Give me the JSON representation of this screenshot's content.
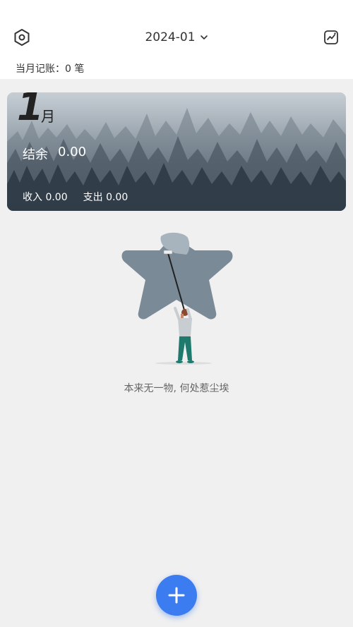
{
  "header": {
    "month": "2024-01",
    "count_label": "当月记账：",
    "count_value": "0 笔"
  },
  "card": {
    "month_number": "1",
    "month_unit": "月",
    "balance_label": "结余",
    "balance_value": "0.00",
    "income_label": "收入",
    "income_value": "0.00",
    "expense_label": "支出",
    "expense_value": "0.00"
  },
  "empty_state": {
    "message": "本来无一物, 何处惹尘埃"
  },
  "icons": {
    "settings": "settings-hexagon-icon",
    "month_dropdown": "chevron-down-icon",
    "stats": "chart-trend-icon",
    "add": "plus-icon"
  },
  "colors": {
    "accent": "#3b7df0",
    "background": "#f0f0f0"
  }
}
